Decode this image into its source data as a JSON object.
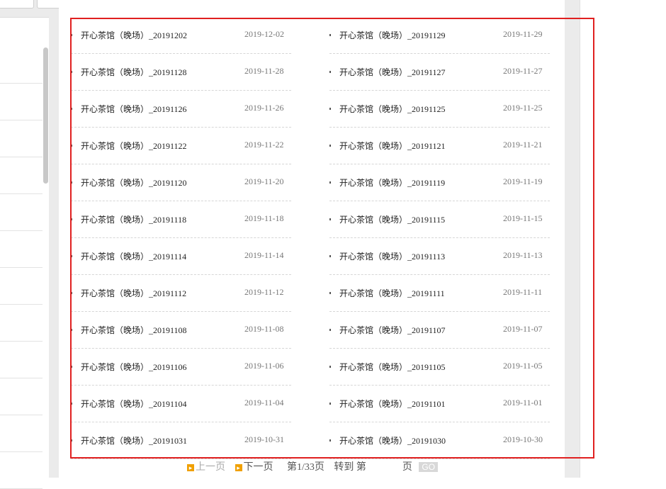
{
  "left_panel": {
    "rows": [
      "",
      "",
      "",
      "",
      "",
      "",
      ")",
      ")",
      ")",
      ")",
      ")",
      ")"
    ]
  },
  "list": {
    "left": [
      {
        "title": "开心茶馆（晚场）_20191202",
        "date": "2019-12-02"
      },
      {
        "title": "开心茶馆（晚场）_20191128",
        "date": "2019-11-28"
      },
      {
        "title": "开心茶馆（晚场）_20191126",
        "date": "2019-11-26"
      },
      {
        "title": "开心茶馆（晚场）_20191122",
        "date": "2019-11-22"
      },
      {
        "title": "开心茶馆（晚场）_20191120",
        "date": "2019-11-20"
      },
      {
        "title": "开心茶馆（晚场）_20191118",
        "date": "2019-11-18"
      },
      {
        "title": "开心茶馆（晚场）_20191114",
        "date": "2019-11-14"
      },
      {
        "title": "开心茶馆（晚场）_20191112",
        "date": "2019-11-12"
      },
      {
        "title": "开心茶馆（晚场）_20191108",
        "date": "2019-11-08"
      },
      {
        "title": "开心茶馆（晚场）_20191106",
        "date": "2019-11-06"
      },
      {
        "title": "开心茶馆（晚场）_20191104",
        "date": "2019-11-04"
      },
      {
        "title": "开心茶馆（晚场）_20191031",
        "date": "2019-10-31"
      }
    ],
    "right": [
      {
        "title": "开心茶馆（晚场）_20191129",
        "date": "2019-11-29"
      },
      {
        "title": "开心茶馆（晚场）_20191127",
        "date": "2019-11-27"
      },
      {
        "title": "开心茶馆（晚场）_20191125",
        "date": "2019-11-25"
      },
      {
        "title": "开心茶馆（晚场）_20191121",
        "date": "2019-11-21"
      },
      {
        "title": "开心茶馆（晚场）_20191119",
        "date": "2019-11-19"
      },
      {
        "title": "开心茶馆（晚场）_20191115",
        "date": "2019-11-15"
      },
      {
        "title": "开心茶馆（晚场）_20191113",
        "date": "2019-11-13"
      },
      {
        "title": "开心茶馆（晚场）_20191111",
        "date": "2019-11-11"
      },
      {
        "title": "开心茶馆（晚场）_20191107",
        "date": "2019-11-07"
      },
      {
        "title": "开心茶馆（晚场）_20191105",
        "date": "2019-11-05"
      },
      {
        "title": "开心茶馆（晚场）_20191101",
        "date": "2019-11-01"
      },
      {
        "title": "开心茶馆（晚场）_20191030",
        "date": "2019-10-30"
      }
    ]
  },
  "pager": {
    "prev_label": "上一页",
    "next_label": "下一页",
    "page_info": "第1/33页",
    "goto_prefix": "转到 第",
    "goto_suffix": "页",
    "go_label": "GO"
  },
  "colors": {
    "selection_box": "#e02020",
    "pager_arrow": "#f0a000"
  }
}
